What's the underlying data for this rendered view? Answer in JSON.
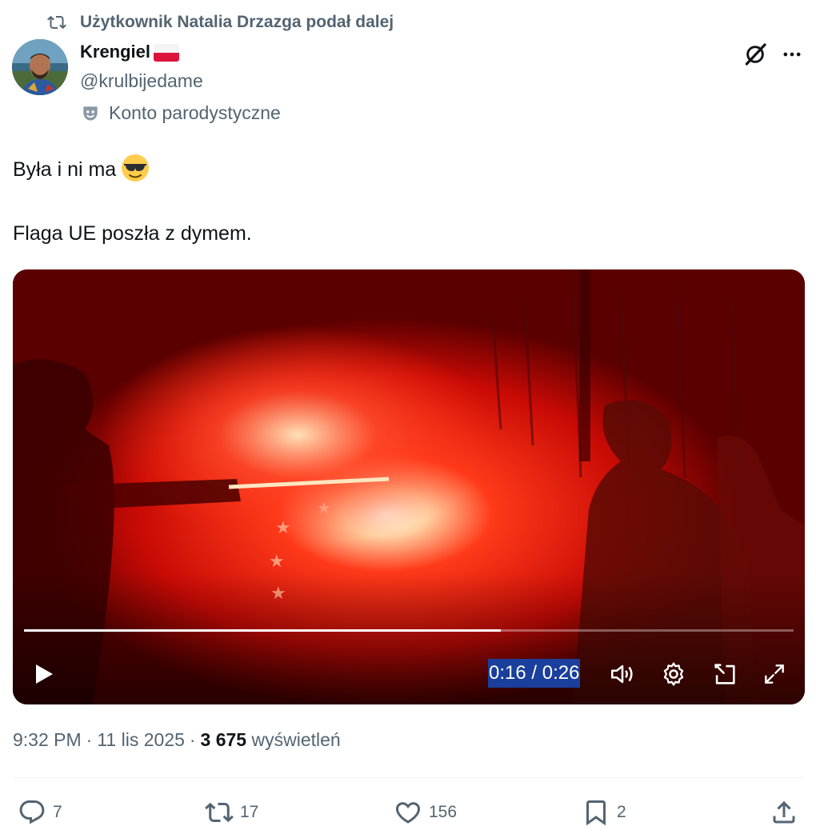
{
  "retweet": {
    "text": "Użytkownik Natalia Drzazga podał dalej"
  },
  "author": {
    "display_name": "Krengiel",
    "handle": "@krulbijedame",
    "label": "Konto parodystyczne"
  },
  "tweet": {
    "line1": "Była i ni ma",
    "line2": "Flaga UE poszła z dymem."
  },
  "video": {
    "time": "0:16 / 0:26",
    "progress": 0.62
  },
  "meta": {
    "time": "9:32 PM",
    "date": "11 lis 2025",
    "views_count": "3 675",
    "views_label": "wyświetleń",
    "sep": "·"
  },
  "actions": {
    "replies": "7",
    "reposts": "17",
    "likes": "156",
    "bookmarks": "2"
  },
  "colors": {
    "secondary_text": "#536471",
    "primary_text": "#0f1419",
    "time_highlight": "#1a3f9c"
  }
}
